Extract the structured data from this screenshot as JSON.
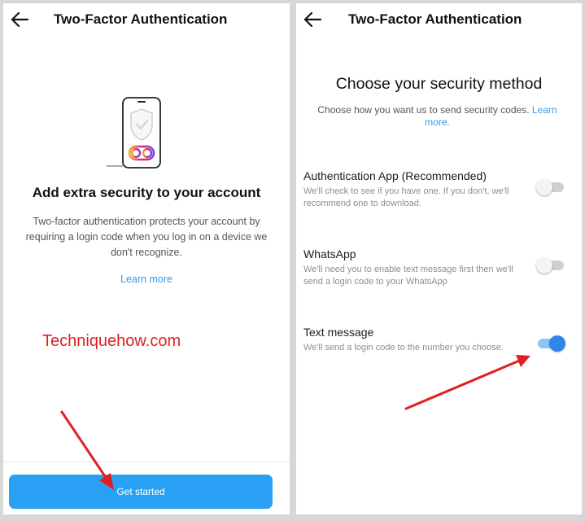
{
  "colors": {
    "accent": "#2aa0f5",
    "link": "#2f9bf0",
    "toggle_on": "#2f86e6",
    "arrow": "#e02020"
  },
  "left_screen": {
    "back_icon": "arrow-left-icon",
    "title": "Two-Factor Authentication",
    "illustration_icon": "phone-shield-check-icon",
    "heading": "Add extra security to your account",
    "description": "Two-factor authentication protects your account by requiring a login code when you log in on a device we don't recognize.",
    "learn_more": "Learn more",
    "watermark": "Techniquehow.com",
    "primary_button": "Get started"
  },
  "right_screen": {
    "back_icon": "arrow-left-icon",
    "title": "Two-Factor Authentication",
    "heading": "Choose your security method",
    "subtitle": "Choose how you want us to send security codes.",
    "learn_more": "Learn more.",
    "options": [
      {
        "title": "Authentication App (Recommended)",
        "description": "We'll check to see if you have one. If you don't, we'll recommend one to download.",
        "enabled": false
      },
      {
        "title": "WhatsApp",
        "description": "We'll need you to enable text message first then we'll send a login code to your WhatsApp",
        "enabled": false
      },
      {
        "title": "Text message",
        "description": "We'll send a login code to the number you choose.",
        "enabled": true
      }
    ]
  }
}
